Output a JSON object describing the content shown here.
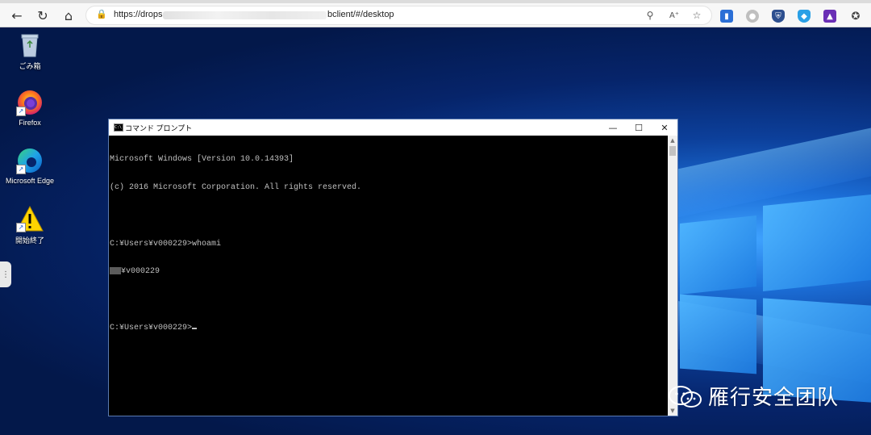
{
  "browser": {
    "url_prefix": "https://drops.",
    "url_suffix": "bclient/#/desktop"
  },
  "desktop": {
    "icons": [
      {
        "label": "ごみ箱",
        "icon": "recycle-bin-icon"
      },
      {
        "label": "Firefox",
        "icon": "firefox-icon"
      },
      {
        "label": "Microsoft Edge",
        "icon": "edge-icon"
      },
      {
        "label": "開始終了",
        "icon": "warning-icon"
      }
    ]
  },
  "cmd": {
    "title": "コマンド プロンプト",
    "lines": [
      "Microsoft Windows [Version 10.0.14393]",
      "(c) 2016 Microsoft Corporation. All rights reserved.",
      "",
      "C:¥Users¥v000229>whoami",
      "¥v000229",
      "",
      "C:¥Users¥v000229>"
    ]
  },
  "watermark": {
    "text": "雁行安全团队"
  },
  "colors": {
    "desktop_dark": "#03184a",
    "desktop_light": "#3fa3ff",
    "console_bg": "#000000",
    "console_text": "#c0c0c0"
  }
}
